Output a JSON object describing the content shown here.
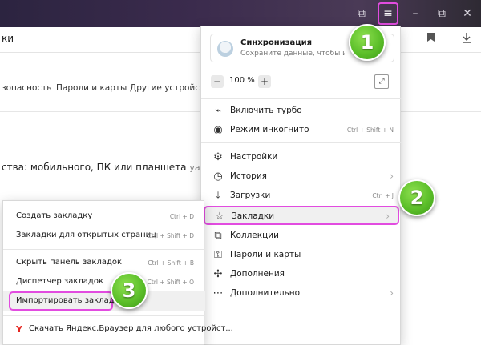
{
  "window": {
    "controls": {
      "tabs_icon": "⧉",
      "menu_icon": "≡",
      "minimize": "–",
      "restore": "⧉",
      "close": "✕"
    }
  },
  "address": {
    "title_fragment": "ки",
    "bookmark_icon": "bookmark-icon",
    "download_icon": "download-icon"
  },
  "settings_tabs": [
    "зопасность",
    "Пароли и карты",
    "Другие устройства"
  ],
  "content": {
    "sync_text": "ства: мобильного, ПК или планшета",
    "sync_url": "yandbrowser."
  },
  "main_menu": {
    "sync": {
      "title": "Синхронизация",
      "subtitle": "Сохраните данные, чтобы их не"
    },
    "zoom": {
      "minus": "−",
      "value": "100 %",
      "plus": "+"
    },
    "items": [
      {
        "icon": "turbo-icon",
        "glyph": "⌁",
        "label": "Включить турбо",
        "shortcut": ""
      },
      {
        "icon": "incognito-icon",
        "glyph": "◉",
        "label": "Режим инкогнито",
        "shortcut": "Ctrl + Shift + N"
      },
      {
        "icon": "gear-icon",
        "glyph": "⚙",
        "label": "Настройки",
        "shortcut": ""
      },
      {
        "icon": "history-icon",
        "glyph": "◷",
        "label": "История",
        "shortcut": "",
        "arrow": "›"
      },
      {
        "icon": "download-icon",
        "glyph": "⤓",
        "label": "Загрузки",
        "shortcut": "Ctrl + J"
      },
      {
        "icon": "star-icon",
        "glyph": "☆",
        "label": "Закладки",
        "shortcut": "",
        "arrow": "›"
      },
      {
        "icon": "collections-icon",
        "glyph": "⧉",
        "label": "Коллекции",
        "shortcut": ""
      },
      {
        "icon": "key-icon",
        "glyph": "⚿",
        "label": "Пароли и карты",
        "shortcut": ""
      },
      {
        "icon": "puzzle-icon",
        "glyph": "✢",
        "label": "Дополнения",
        "shortcut": ""
      },
      {
        "icon": "more-icon",
        "glyph": "⋯",
        "label": "Дополнительно",
        "shortcut": "",
        "arrow": "›"
      }
    ]
  },
  "bookmarks_menu": {
    "items": [
      {
        "label": "Создать закладку",
        "shortcut": "Ctrl + D"
      },
      {
        "label": "Закладки для открытых страниц",
        "shortcut": "Ctrl + Shift + D"
      },
      {
        "label": "Скрыть панель закладок",
        "shortcut": "Ctrl + Shift + B"
      },
      {
        "label": "Диспетчер закладок",
        "shortcut": "Ctrl + Shift + O"
      },
      {
        "label": "Импортировать закладки",
        "shortcut": ""
      },
      {
        "label": "Скачать Яндекс.Браузер для любого устройст...",
        "shortcut": ""
      }
    ],
    "yandex_logo": "Y"
  },
  "callouts": [
    "1",
    "2",
    "3"
  ],
  "colors": {
    "highlight_border": "#e24ce0",
    "callout_green": "#5cbf2a",
    "titlebar": "#3b2b4d"
  }
}
